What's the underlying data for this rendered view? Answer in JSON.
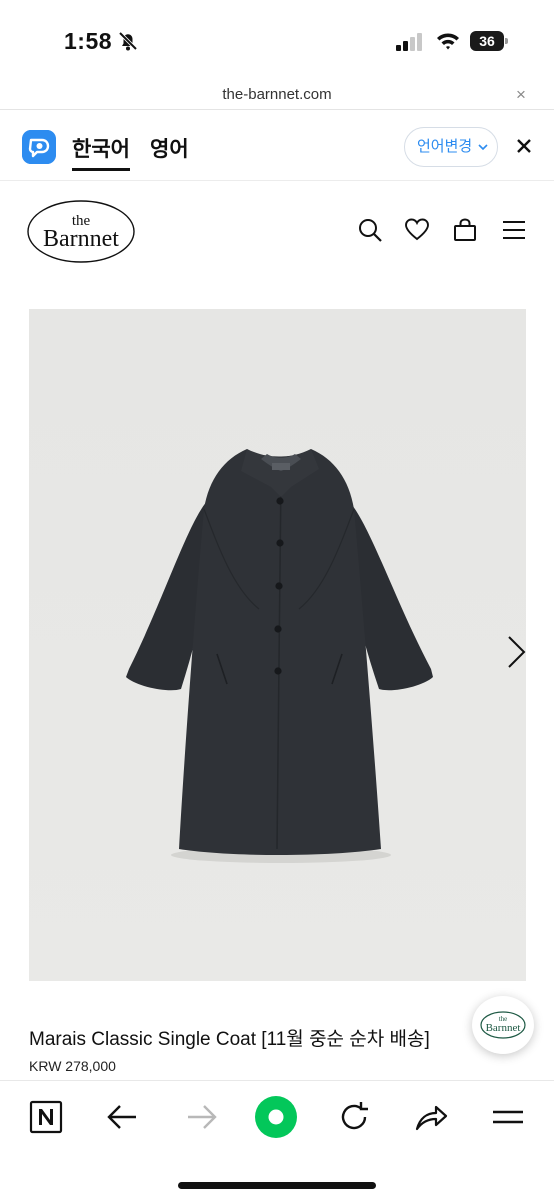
{
  "status_bar": {
    "time": "1:58",
    "battery_level": "36",
    "icons": [
      "bell-slash-icon",
      "cellular-signal-icon",
      "wifi-icon",
      "battery-icon"
    ]
  },
  "browser": {
    "url": "the-barnnet.com",
    "close_glyph": "×"
  },
  "translate_bar": {
    "tabs": [
      {
        "label": "한국어",
        "active": true
      },
      {
        "label": "영어",
        "active": false
      }
    ],
    "change_language_label": "언어변경",
    "accent_color": "#2d8cf0"
  },
  "site": {
    "logo_text_small": "the",
    "logo_text_large": "Barnnet",
    "header_icons": [
      "search-icon",
      "heart-icon",
      "shopping-bag-icon",
      "menu-icon"
    ]
  },
  "product": {
    "title": "Marais Classic Single Coat [11월 중순 순차 배송]",
    "price": "KRW 278,000",
    "image_alt": "coat-image"
  },
  "chat_fab": {
    "logo_text_small": "the",
    "logo_text_large": "Barnnet"
  },
  "toolbar": {
    "icons": [
      "naver-icon",
      "back-arrow-icon",
      "forward-arrow-icon",
      "green-home-icon",
      "reload-icon",
      "share-icon",
      "hamburger-icon"
    ],
    "accent_color": "#03c75a"
  }
}
